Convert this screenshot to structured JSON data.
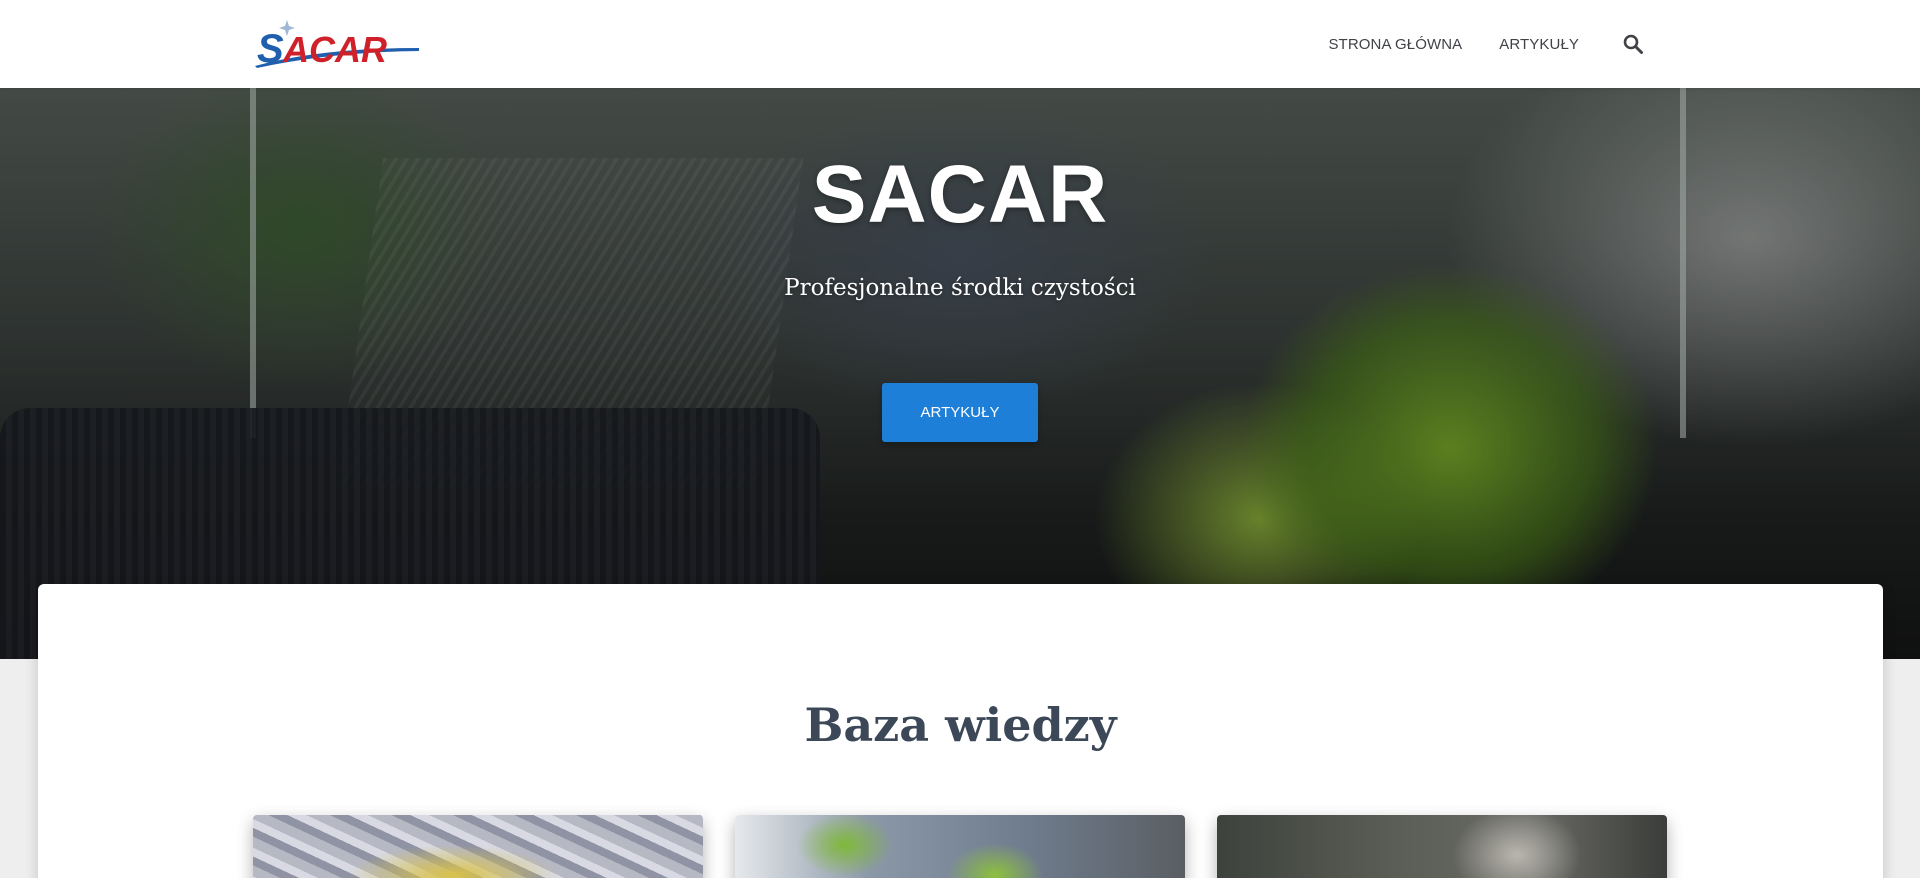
{
  "header": {
    "logo_text": "SACAR",
    "nav": [
      {
        "label": "STRONA GŁÓWNA"
      },
      {
        "label": "ARTYKUŁY"
      }
    ],
    "search_icon": "search-icon"
  },
  "hero": {
    "title": "SACAR",
    "subtitle": "Profesjonalne środki czystości",
    "button_label": "ARTYKUŁY"
  },
  "main": {
    "section_title": "Baza wiedzy",
    "posts": [
      {
        "thumbnail": "foil-food-image"
      },
      {
        "thumbnail": "sofa-plants-image"
      },
      {
        "thumbnail": "kitchen-cleaning-image"
      }
    ]
  },
  "colors": {
    "accent": "#1e7fd8",
    "heading": "#3c4858",
    "nav_text": "#404248",
    "logo_blue": "#1f5fae",
    "logo_red": "#d0202a"
  }
}
